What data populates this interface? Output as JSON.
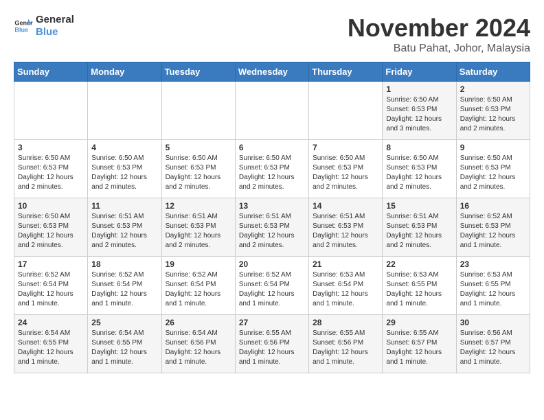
{
  "logo": {
    "line1": "General",
    "line2": "Blue"
  },
  "title": "November 2024",
  "location": "Batu Pahat, Johor, Malaysia",
  "days_of_week": [
    "Sunday",
    "Monday",
    "Tuesday",
    "Wednesday",
    "Thursday",
    "Friday",
    "Saturday"
  ],
  "weeks": [
    [
      {
        "day": "",
        "info": ""
      },
      {
        "day": "",
        "info": ""
      },
      {
        "day": "",
        "info": ""
      },
      {
        "day": "",
        "info": ""
      },
      {
        "day": "",
        "info": ""
      },
      {
        "day": "1",
        "info": "Sunrise: 6:50 AM\nSunset: 6:53 PM\nDaylight: 12 hours and 3 minutes."
      },
      {
        "day": "2",
        "info": "Sunrise: 6:50 AM\nSunset: 6:53 PM\nDaylight: 12 hours and 2 minutes."
      }
    ],
    [
      {
        "day": "3",
        "info": "Sunrise: 6:50 AM\nSunset: 6:53 PM\nDaylight: 12 hours and 2 minutes."
      },
      {
        "day": "4",
        "info": "Sunrise: 6:50 AM\nSunset: 6:53 PM\nDaylight: 12 hours and 2 minutes."
      },
      {
        "day": "5",
        "info": "Sunrise: 6:50 AM\nSunset: 6:53 PM\nDaylight: 12 hours and 2 minutes."
      },
      {
        "day": "6",
        "info": "Sunrise: 6:50 AM\nSunset: 6:53 PM\nDaylight: 12 hours and 2 minutes."
      },
      {
        "day": "7",
        "info": "Sunrise: 6:50 AM\nSunset: 6:53 PM\nDaylight: 12 hours and 2 minutes."
      },
      {
        "day": "8",
        "info": "Sunrise: 6:50 AM\nSunset: 6:53 PM\nDaylight: 12 hours and 2 minutes."
      },
      {
        "day": "9",
        "info": "Sunrise: 6:50 AM\nSunset: 6:53 PM\nDaylight: 12 hours and 2 minutes."
      }
    ],
    [
      {
        "day": "10",
        "info": "Sunrise: 6:50 AM\nSunset: 6:53 PM\nDaylight: 12 hours and 2 minutes."
      },
      {
        "day": "11",
        "info": "Sunrise: 6:51 AM\nSunset: 6:53 PM\nDaylight: 12 hours and 2 minutes."
      },
      {
        "day": "12",
        "info": "Sunrise: 6:51 AM\nSunset: 6:53 PM\nDaylight: 12 hours and 2 minutes."
      },
      {
        "day": "13",
        "info": "Sunrise: 6:51 AM\nSunset: 6:53 PM\nDaylight: 12 hours and 2 minutes."
      },
      {
        "day": "14",
        "info": "Sunrise: 6:51 AM\nSunset: 6:53 PM\nDaylight: 12 hours and 2 minutes."
      },
      {
        "day": "15",
        "info": "Sunrise: 6:51 AM\nSunset: 6:53 PM\nDaylight: 12 hours and 2 minutes."
      },
      {
        "day": "16",
        "info": "Sunrise: 6:52 AM\nSunset: 6:53 PM\nDaylight: 12 hours and 1 minute."
      }
    ],
    [
      {
        "day": "17",
        "info": "Sunrise: 6:52 AM\nSunset: 6:54 PM\nDaylight: 12 hours and 1 minute."
      },
      {
        "day": "18",
        "info": "Sunrise: 6:52 AM\nSunset: 6:54 PM\nDaylight: 12 hours and 1 minute."
      },
      {
        "day": "19",
        "info": "Sunrise: 6:52 AM\nSunset: 6:54 PM\nDaylight: 12 hours and 1 minute."
      },
      {
        "day": "20",
        "info": "Sunrise: 6:52 AM\nSunset: 6:54 PM\nDaylight: 12 hours and 1 minute."
      },
      {
        "day": "21",
        "info": "Sunrise: 6:53 AM\nSunset: 6:54 PM\nDaylight: 12 hours and 1 minute."
      },
      {
        "day": "22",
        "info": "Sunrise: 6:53 AM\nSunset: 6:55 PM\nDaylight: 12 hours and 1 minute."
      },
      {
        "day": "23",
        "info": "Sunrise: 6:53 AM\nSunset: 6:55 PM\nDaylight: 12 hours and 1 minute."
      }
    ],
    [
      {
        "day": "24",
        "info": "Sunrise: 6:54 AM\nSunset: 6:55 PM\nDaylight: 12 hours and 1 minute."
      },
      {
        "day": "25",
        "info": "Sunrise: 6:54 AM\nSunset: 6:55 PM\nDaylight: 12 hours and 1 minute."
      },
      {
        "day": "26",
        "info": "Sunrise: 6:54 AM\nSunset: 6:56 PM\nDaylight: 12 hours and 1 minute."
      },
      {
        "day": "27",
        "info": "Sunrise: 6:55 AM\nSunset: 6:56 PM\nDaylight: 12 hours and 1 minute."
      },
      {
        "day": "28",
        "info": "Sunrise: 6:55 AM\nSunset: 6:56 PM\nDaylight: 12 hours and 1 minute."
      },
      {
        "day": "29",
        "info": "Sunrise: 6:55 AM\nSunset: 6:57 PM\nDaylight: 12 hours and 1 minute."
      },
      {
        "day": "30",
        "info": "Sunrise: 6:56 AM\nSunset: 6:57 PM\nDaylight: 12 hours and 1 minute."
      }
    ]
  ]
}
